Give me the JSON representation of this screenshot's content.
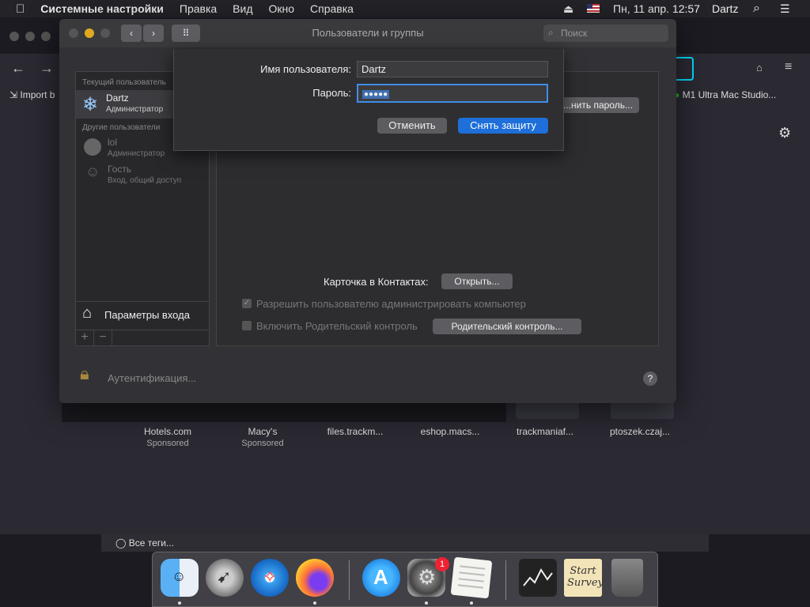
{
  "menubar": {
    "apple_icon": "apple-icon",
    "app_name": "Системные настройки",
    "items": [
      "Правка",
      "Вид",
      "Окно",
      "Справка"
    ],
    "datetime": "Пн, 11 апр.  12:57",
    "user": "Dartz"
  },
  "firefox": {
    "bookmarks": {
      "import": "Import b",
      "m1": "M1 Ultra Mac Studio..."
    },
    "tiles": [
      {
        "title": "Hotels.com",
        "sub": "Sponsored"
      },
      {
        "title": "Macy's",
        "sub": "Sponsored"
      },
      {
        "title": "files.trackm...",
        "sub": ""
      },
      {
        "title": "eshop.macs...",
        "sub": ""
      },
      {
        "title": "trackmaniaf...",
        "sub": ""
      },
      {
        "title": "ptoszek.czaj...",
        "sub": ""
      }
    ],
    "tags_label": "Все теги..."
  },
  "prefs": {
    "title": "Пользователи и группы",
    "search_placeholder": "Поиск",
    "current_section": "Текущий пользователь",
    "current_user": {
      "name": "Dartz",
      "role": "Администратор"
    },
    "other_section": "Другие пользователи",
    "others": [
      {
        "name": "lol",
        "role": "Администратор"
      },
      {
        "name": "Гость",
        "role": "Вход, общий доступ"
      }
    ],
    "login_options": "Параметры входа",
    "add_label": "+",
    "remove_label": "−",
    "change_password": "...нить пароль...",
    "contacts_label": "Карточка в Контактах:",
    "open_button": "Открыть...",
    "allow_admin": "Разрешить пользователю администрировать компьютер",
    "parental_checkbox": "Включить Родительский контроль",
    "parental_button": "Родительский контроль...",
    "auth_label": "Аутентификация...",
    "help": "?"
  },
  "sheet": {
    "username_label": "Имя пользователя:",
    "username_value": "Dartz",
    "password_label": "Пароль:",
    "password_value": "●●●●●",
    "cancel": "Отменить",
    "unlock": "Снять защиту"
  },
  "dock": {
    "apps": [
      "finder-icon",
      "launchpad-icon",
      "safari-icon",
      "firefox-icon",
      "app-store-icon",
      "system-preferences-icon",
      "textedit-icon",
      "stocks-icon",
      "start-survey-icon",
      "trash-icon"
    ],
    "notes_text": "Start Survey",
    "badge": "1"
  },
  "colors": {
    "accent": "#1e6fd9",
    "firefox_orange": "#ff7139"
  }
}
